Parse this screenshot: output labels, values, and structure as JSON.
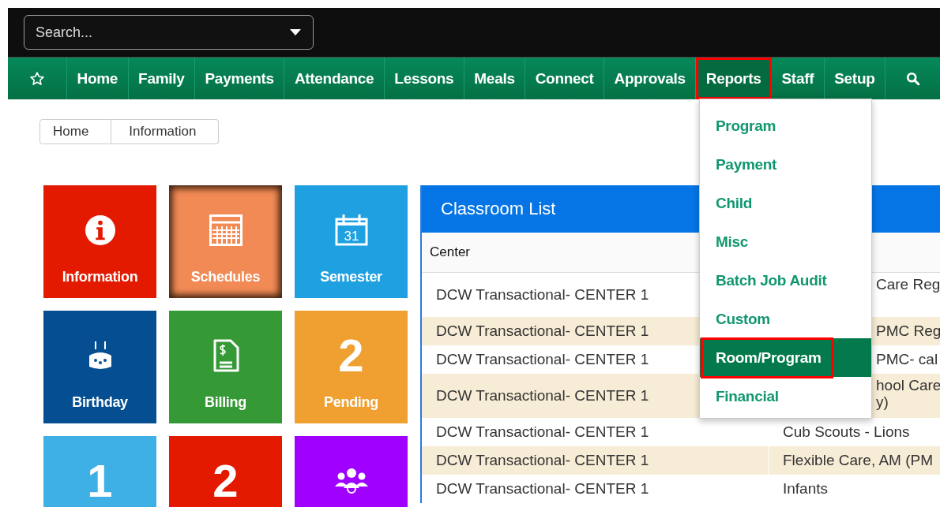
{
  "search": {
    "placeholder": "Search..."
  },
  "nav": [
    {
      "kind": "star"
    },
    {
      "kind": "link",
      "label": "Home",
      "selected": false,
      "outlined": false
    },
    {
      "kind": "link",
      "label": "Family",
      "selected": false,
      "outlined": false
    },
    {
      "kind": "link",
      "label": "Payments",
      "selected": false,
      "outlined": false
    },
    {
      "kind": "link",
      "label": "Attendance",
      "selected": false,
      "outlined": false
    },
    {
      "kind": "link",
      "label": "Lessons",
      "selected": false,
      "outlined": false
    },
    {
      "kind": "link",
      "label": "Meals",
      "selected": false,
      "outlined": false
    },
    {
      "kind": "link",
      "label": "Connect",
      "selected": false,
      "outlined": false
    },
    {
      "kind": "link",
      "label": "Approvals",
      "selected": false,
      "outlined": false
    },
    {
      "kind": "link",
      "label": "Reports",
      "selected": true,
      "outlined": true
    },
    {
      "kind": "link",
      "label": "Staff",
      "selected": false,
      "outlined": false
    },
    {
      "kind": "link",
      "label": "Setup",
      "selected": false,
      "outlined": false
    },
    {
      "kind": "search"
    }
  ],
  "reports_menu": [
    {
      "label": "Program",
      "selected": false,
      "outlined": false
    },
    {
      "label": "Payment",
      "selected": false,
      "outlined": false
    },
    {
      "label": "Child",
      "selected": false,
      "outlined": false
    },
    {
      "label": "Misc",
      "selected": false,
      "outlined": false
    },
    {
      "label": "Batch Job Audit",
      "selected": false,
      "outlined": false
    },
    {
      "label": "Custom",
      "selected": false,
      "outlined": false
    },
    {
      "label": "Room/Program",
      "selected": true,
      "outlined": true
    },
    {
      "label": "Financial",
      "selected": false,
      "outlined": false
    }
  ],
  "breadcrumb": [
    "Home",
    "Information"
  ],
  "tiles": [
    {
      "kind": "info",
      "label": "Information",
      "color": "#e31a00",
      "highlighted": false
    },
    {
      "kind": "schedule",
      "label": "Schedules",
      "color": "#f28a55",
      "highlighted": true
    },
    {
      "kind": "calendar",
      "label": "Semester",
      "icon_text": "31",
      "color": "#1fa0e0",
      "highlighted": false
    },
    {
      "kind": "cake",
      "label": "Birthday",
      "color": "#054e91",
      "highlighted": false
    },
    {
      "kind": "bill",
      "label": "Billing",
      "color": "#359a36",
      "highlighted": false
    },
    {
      "kind": "number",
      "number": "2",
      "label": "Pending",
      "color": "#f0a030",
      "highlighted": false
    },
    {
      "kind": "number",
      "number": "1",
      "color": "#3fb0e6",
      "highlighted": false
    },
    {
      "kind": "number",
      "number": "2",
      "color": "#e31a00",
      "highlighted": false
    },
    {
      "kind": "people",
      "color": "#a000ff",
      "highlighted": false
    }
  ],
  "classroom_list": {
    "title": "Classroom List",
    "columns": [
      "Center"
    ],
    "rows": [
      {
        "center": "DCW Transactional- CENTER 1",
        "program": "Care Reg",
        "covered": true,
        "tall": true
      },
      {
        "center": "DCW Transactional- CENTER 1",
        "program": "PMC Reg",
        "covered": true,
        "tall": false
      },
      {
        "center": "DCW Transactional- CENTER 1",
        "program": "PMC- cal",
        "covered": true,
        "tall": false
      },
      {
        "center": "DCW Transactional- CENTER 1",
        "program": "hool Care",
        "program_line2": "y)",
        "covered": true,
        "tall": true
      },
      {
        "center": "DCW Transactional- CENTER 1",
        "program": "Cub Scouts - Lions",
        "covered": false,
        "tall": false
      },
      {
        "center": "DCW Transactional- CENTER 1",
        "program": "Flexible Care, AM (PM",
        "covered": false,
        "tall": false
      },
      {
        "center": "DCW Transactional- CENTER 1",
        "program": "Infants",
        "covered": false,
        "tall": false
      }
    ]
  }
}
